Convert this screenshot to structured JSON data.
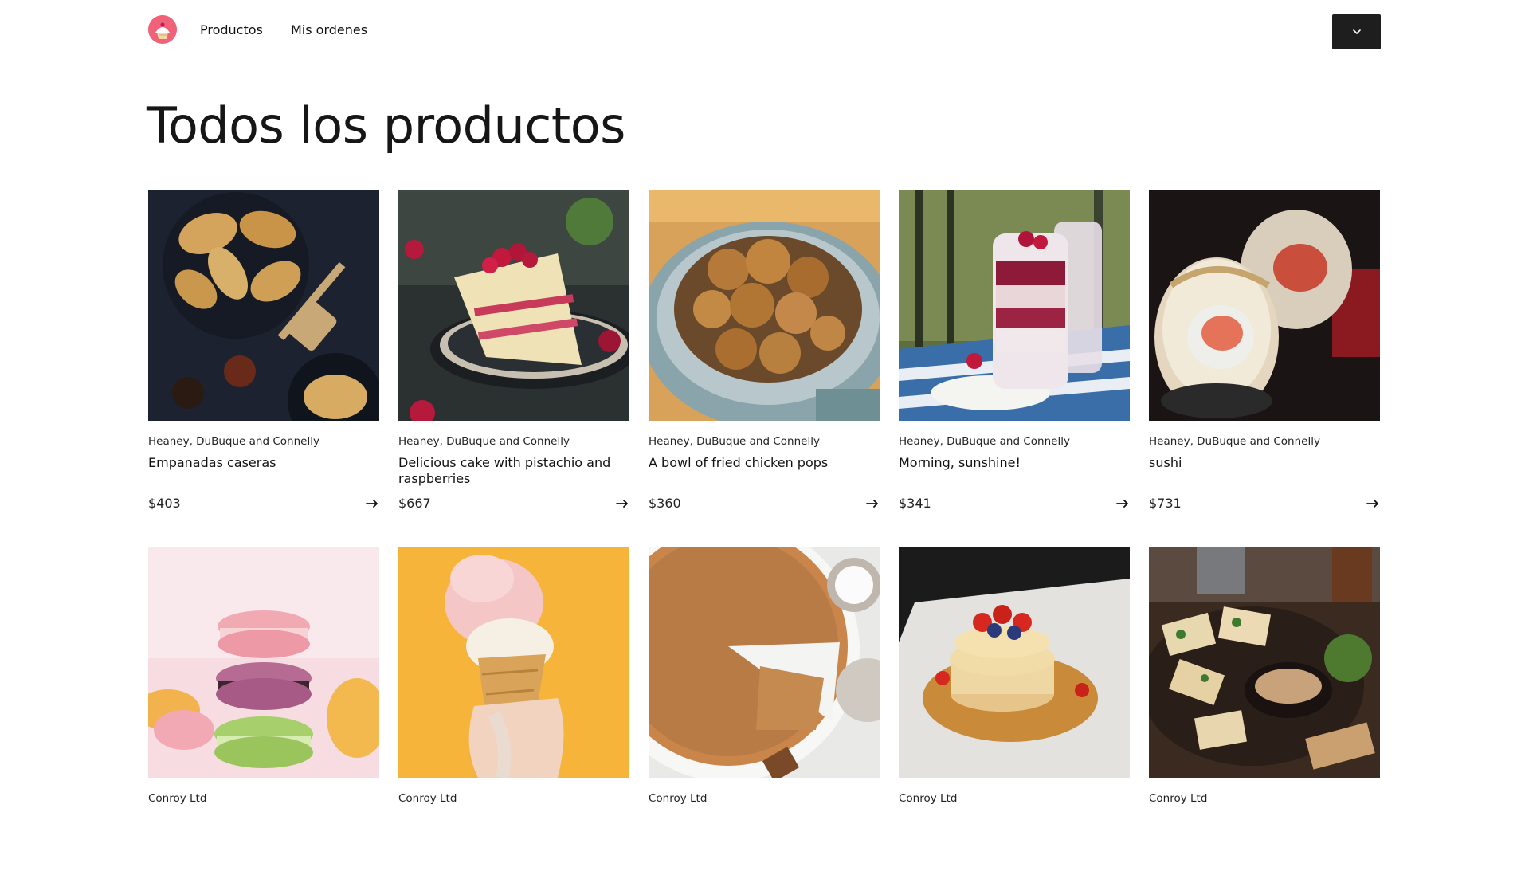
{
  "header": {
    "logo": {
      "icon": "cupcake-logo-icon",
      "color": "#f0627a"
    },
    "nav": [
      {
        "label": "Productos"
      },
      {
        "label": "Mis ordenes"
      }
    ],
    "user_menu": {
      "icon": "chevron-down-icon",
      "background": "#1e1e1e"
    }
  },
  "page": {
    "title": "Todos los productos"
  },
  "products": [
    {
      "vendor": "Heaney, DuBuque and Connelly",
      "name": "Empanadas caseras",
      "price": "$403"
    },
    {
      "vendor": "Heaney, DuBuque and Connelly",
      "name": "Delicious cake with pistachio and raspberries",
      "price": "$667"
    },
    {
      "vendor": "Heaney, DuBuque and Connelly",
      "name": "A bowl of fried chicken pops",
      "price": "$360"
    },
    {
      "vendor": "Heaney, DuBuque and Connelly",
      "name": "Morning, sunshine!",
      "price": "$341"
    },
    {
      "vendor": "Heaney, DuBuque and Connelly",
      "name": "sushi",
      "price": "$731"
    },
    {
      "vendor": "Conroy Ltd",
      "name": "",
      "price": ""
    },
    {
      "vendor": "Conroy Ltd",
      "name": "",
      "price": ""
    },
    {
      "vendor": "Conroy Ltd",
      "name": "",
      "price": ""
    },
    {
      "vendor": "Conroy Ltd",
      "name": "",
      "price": ""
    },
    {
      "vendor": "Conroy Ltd",
      "name": "",
      "price": ""
    }
  ]
}
